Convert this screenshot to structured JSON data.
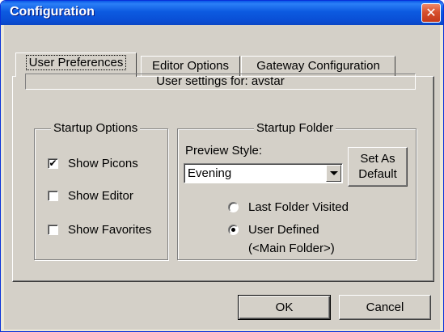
{
  "window": {
    "title": "Configuration",
    "close_glyph": "✕"
  },
  "tabs": [
    {
      "label": "User Preferences",
      "active": true
    },
    {
      "label": "Editor Options",
      "active": false
    },
    {
      "label": "Gateway Configuration",
      "active": false
    }
  ],
  "user_settings_text": "User settings for: avstar",
  "startup_options": {
    "legend": "Startup Options",
    "items": [
      {
        "label": "Show Picons",
        "checked": true,
        "check_glyph": "✔"
      },
      {
        "label": "Show Editor",
        "checked": false
      },
      {
        "label": "Show Favorites",
        "checked": false
      }
    ]
  },
  "startup_folder": {
    "legend": "Startup Folder",
    "preview_style_label": "Preview Style:",
    "preview_style_value": "Evening",
    "set_default_line1": "Set As",
    "set_default_line2": "Default",
    "radios": [
      {
        "label": "Last Folder Visited",
        "selected": false
      },
      {
        "label": "User Defined",
        "selected": true,
        "sublabel": "(<Main Folder>)"
      }
    ]
  },
  "buttons": {
    "ok": "OK",
    "cancel": "Cancel"
  },
  "colors": {
    "title_bar": "#0a58e8",
    "close_button": "#d7502d",
    "face": "#d4d0c8"
  }
}
